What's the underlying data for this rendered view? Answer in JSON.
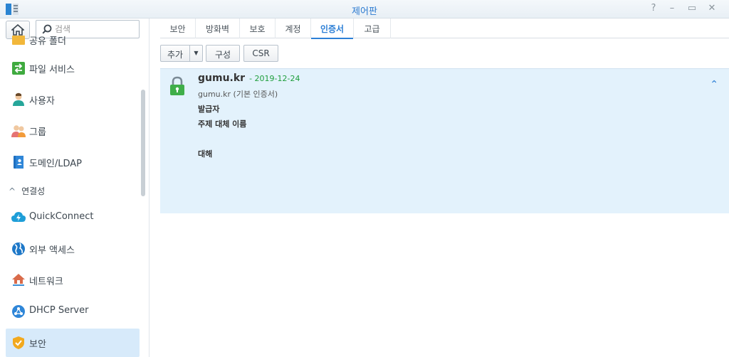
{
  "window": {
    "title": "제어판",
    "controls": [
      "?",
      "–",
      "▭",
      "✕"
    ]
  },
  "search": {
    "placeholder": "검색"
  },
  "sidebar": {
    "items": [
      {
        "label": "공유 폴더",
        "icon": "folder-icon"
      },
      {
        "label": "파일 서비스",
        "icon": "file-services-icon"
      },
      {
        "label": "사용자",
        "icon": "user-icon"
      },
      {
        "label": "그룹",
        "icon": "group-icon"
      },
      {
        "label": "도메인/LDAP",
        "icon": "directory-icon"
      }
    ],
    "section": {
      "label": "연결성",
      "icon": "chevron-up-icon"
    },
    "connectivity_items": [
      {
        "label": "QuickConnect",
        "icon": "quickconnect-icon"
      },
      {
        "label": "외부 액세스",
        "icon": "globe-icon"
      },
      {
        "label": "네트워크",
        "icon": "network-icon"
      },
      {
        "label": "DHCP Server",
        "icon": "dhcp-icon"
      },
      {
        "label": "보안",
        "icon": "shield-icon",
        "active": true
      }
    ]
  },
  "tabs": [
    {
      "label": "보안"
    },
    {
      "label": "방화벽"
    },
    {
      "label": "보호"
    },
    {
      "label": "계정"
    },
    {
      "label": "인증서",
      "active": true
    },
    {
      "label": "고급"
    }
  ],
  "toolbar": {
    "add_label": "추가",
    "configure_label": "구성",
    "csr_label": "CSR"
  },
  "certificate": {
    "name": "gumu.kr",
    "date": "- 2019-12-24",
    "subtitle": "gumu.kr (기본 인증서)",
    "issuer_label": "발급자",
    "san_label": "주제 대체 이름",
    "for_label": "대해"
  },
  "colors": {
    "accent": "#2c7fd6",
    "active_bg": "#d7eafa",
    "card_bg": "#e3f2fc",
    "date_green": "#1e9e3c",
    "lock_green": "#3fae49"
  }
}
